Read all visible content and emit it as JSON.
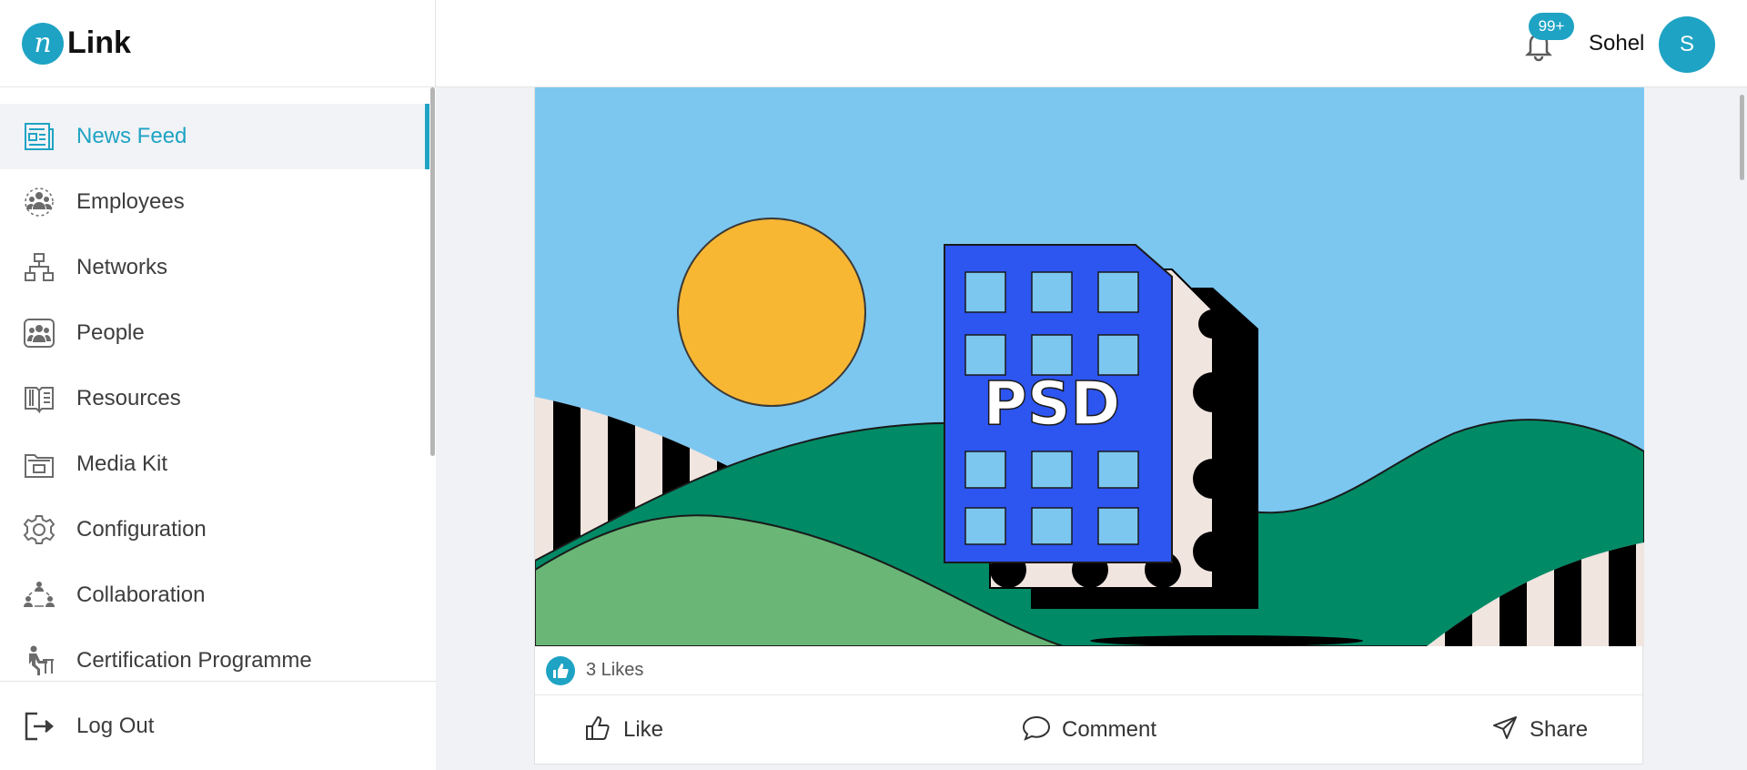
{
  "app": {
    "logo_mark": "n",
    "logo_text": "Link"
  },
  "sidebar": {
    "items": [
      {
        "label": "News Feed",
        "icon": "newspaper-icon",
        "active": true
      },
      {
        "label": "Employees",
        "icon": "employees-icon"
      },
      {
        "label": "Networks",
        "icon": "network-icon"
      },
      {
        "label": "People",
        "icon": "people-icon"
      },
      {
        "label": "Resources",
        "icon": "book-icon"
      },
      {
        "label": "Media Kit",
        "icon": "media-kit-icon"
      },
      {
        "label": "Configuration",
        "icon": "gear-icon"
      },
      {
        "label": "Collaboration",
        "icon": "collaboration-icon"
      },
      {
        "label": "Certification Programme",
        "icon": "certification-icon"
      }
    ],
    "logout_label": "Log Out"
  },
  "header": {
    "notification_count": "99+",
    "user_name": "Sohel",
    "avatar_initial": "S"
  },
  "post": {
    "image_text": "PSD",
    "likes_text": "3 Likes",
    "actions": {
      "like": "Like",
      "comment": "Comment",
      "share": "Share"
    }
  },
  "colors": {
    "accent": "#1fa3c4",
    "sky": "#7cc7f0",
    "sun": "#f7b733",
    "file_blue": "#2d55f0",
    "hill_dark": "#008a66",
    "hill_light": "#6ab676"
  }
}
